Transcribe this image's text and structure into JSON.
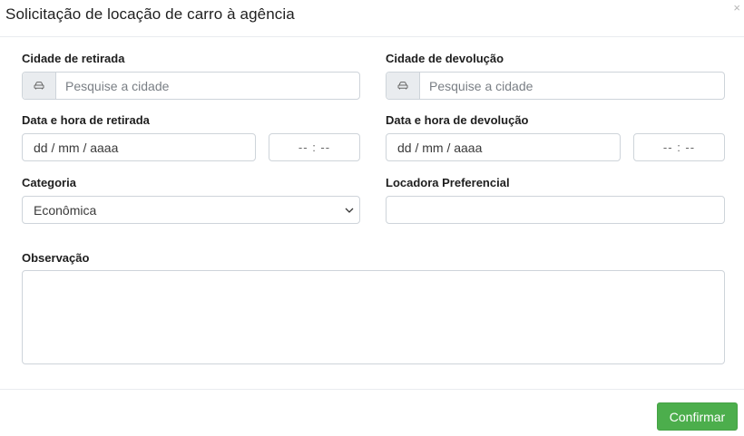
{
  "modal": {
    "title": "Solicitação de locação de carro à agência",
    "close_icon": "close-icon",
    "close_glyph": "×"
  },
  "pickup_city": {
    "label": "Cidade de retirada",
    "placeholder": "Pesquise a cidade",
    "icon": "car-icon"
  },
  "return_city": {
    "label": "Cidade de devolução",
    "placeholder": "Pesquise a cidade",
    "icon": "car-icon"
  },
  "pickup_datetime": {
    "label": "Data e hora de retirada",
    "date_placeholder": "dd / mm / aaaa",
    "time_placeholder": "-- : --"
  },
  "return_datetime": {
    "label": "Data e hora de devolução",
    "date_placeholder": "dd / mm / aaaa",
    "time_placeholder": "-- : --"
  },
  "category": {
    "label": "Categoria",
    "selected": "Econômica",
    "icon": "chevron-down-icon"
  },
  "preferred_agency": {
    "label": "Locadora Preferencial",
    "value": ""
  },
  "notes": {
    "label": "Observação",
    "value": ""
  },
  "footer": {
    "confirm_label": "Confirmar"
  },
  "colors": {
    "confirm_button": "#4cae4c",
    "border": "#ced4da",
    "addon_bg": "#e9ecef"
  }
}
